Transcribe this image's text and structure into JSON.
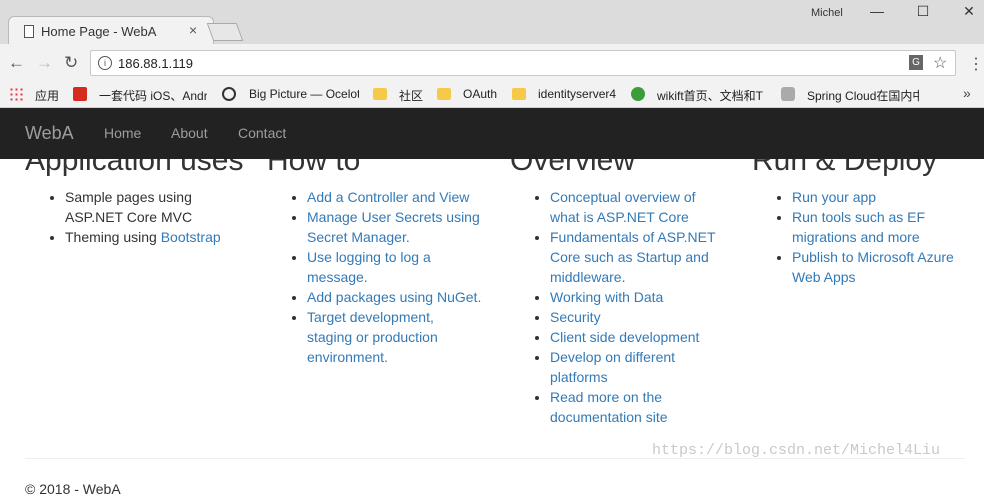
{
  "browser": {
    "tab_title": "Home Page - WebA",
    "tab_close": "×",
    "user": "Michel",
    "window_controls": {
      "minimize": "—",
      "maximize": "☐",
      "close": "✕"
    },
    "url": "186.88.1.119",
    "icons": {
      "back": "←",
      "forward": "→",
      "reload": "↻",
      "info": "i",
      "translate": "G",
      "star": "☆",
      "menu": "⋮",
      "more": "»"
    },
    "bookmarks": [
      {
        "label": "应用",
        "icon": "apps-icon"
      },
      {
        "label": "一套代码 iOS、Andr",
        "icon": "red-icon"
      },
      {
        "label": "Big Picture — Ocelot",
        "icon": "circle-icon"
      },
      {
        "label": "社区",
        "icon": "folder-icon"
      },
      {
        "label": "OAuth",
        "icon": "folder-icon"
      },
      {
        "label": "identityserver4",
        "icon": "folder-icon"
      },
      {
        "label": "wikift首页、文档和T",
        "icon": "green-icon"
      },
      {
        "label": "Spring Cloud在国内中",
        "icon": "gray-icon"
      }
    ]
  },
  "site": {
    "brand": "WebA",
    "nav": [
      "Home",
      "About",
      "Contact"
    ],
    "columns": [
      {
        "heading": "Application uses",
        "items": [
          {
            "text": "Sample pages using ASP.NET Core MVC"
          },
          {
            "text": "Theming using ",
            "link": "Bootstrap"
          }
        ]
      },
      {
        "heading": "How to",
        "items": [
          {
            "link": "Add a Controller and View"
          },
          {
            "link": "Manage User Secrets using Secret Manager."
          },
          {
            "link": "Use logging to log a message."
          },
          {
            "link": "Add packages using NuGet."
          },
          {
            "link": "Target development, staging or production environment."
          }
        ]
      },
      {
        "heading": "Overview",
        "items": [
          {
            "link": "Conceptual overview of what is ASP.NET Core"
          },
          {
            "link": "Fundamentals of ASP.NET Core such as Startup and middleware."
          },
          {
            "link": "Working with Data"
          },
          {
            "link": "Security"
          },
          {
            "link": "Client side development"
          },
          {
            "link": "Develop on different platforms"
          },
          {
            "link": "Read more on the documentation site"
          }
        ]
      },
      {
        "heading": "Run & Deploy",
        "items": [
          {
            "link": "Run your app"
          },
          {
            "link": "Run tools such as EF migrations and more"
          },
          {
            "link": "Publish to Microsoft Azure Web Apps"
          }
        ]
      }
    ],
    "footer": "© 2018 - WebA",
    "watermark": "https://blog.csdn.net/Michel4Liu"
  }
}
